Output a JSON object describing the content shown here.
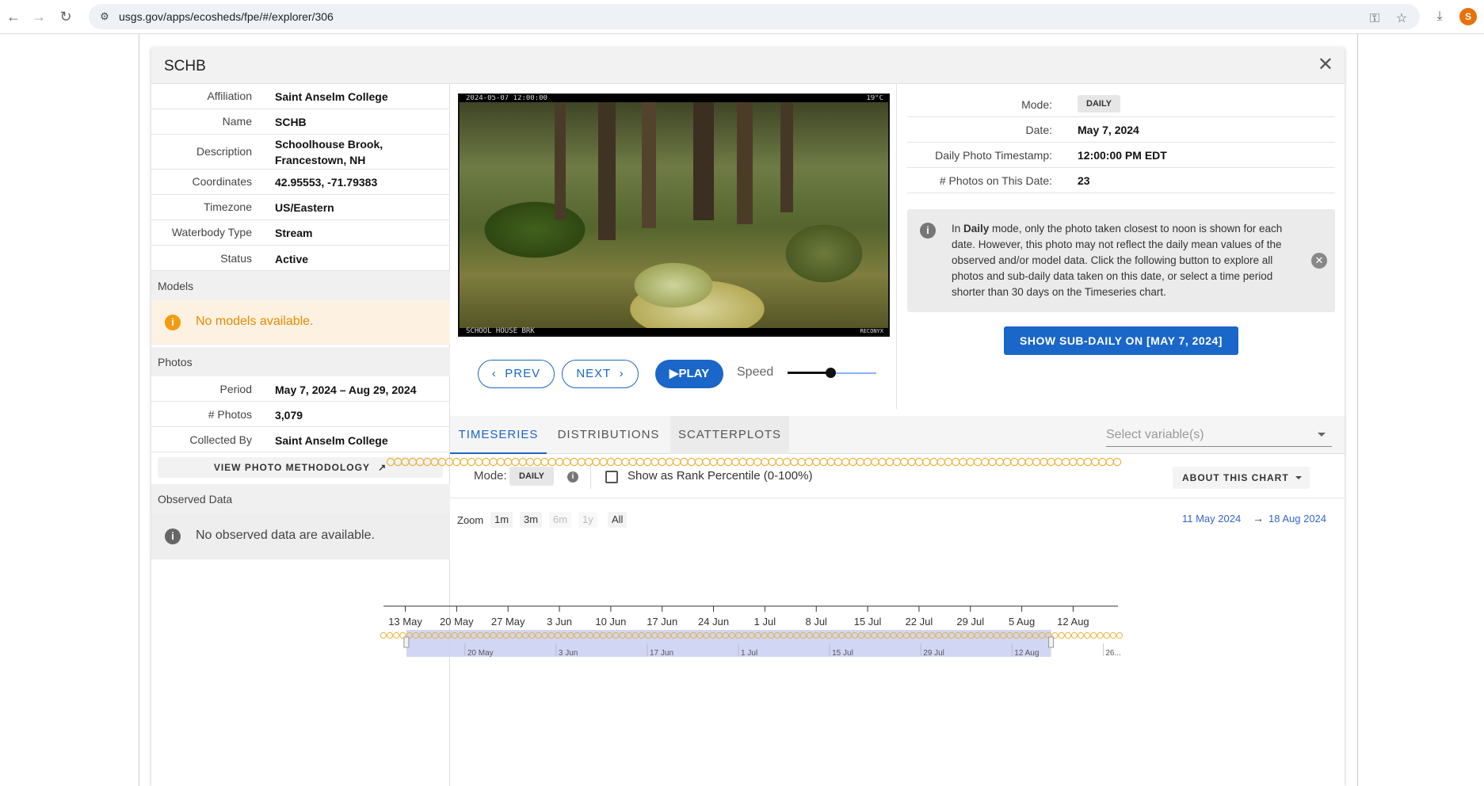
{
  "browser": {
    "url": "usgs.gov/apps/ecosheds/fpe/#/explorer/306",
    "profile_initial": "S"
  },
  "panel": {
    "title": "SCHB",
    "info": [
      {
        "label": "Affiliation",
        "value": "Saint Anselm College"
      },
      {
        "label": "Name",
        "value": "SCHB"
      },
      {
        "label": "Description",
        "value": "Schoolhouse Brook, Francestown, NH"
      },
      {
        "label": "Coordinates",
        "value": "42.95553, -71.79383"
      },
      {
        "label": "Timezone",
        "value": "US/Eastern"
      },
      {
        "label": "Waterbody Type",
        "value": "Stream"
      },
      {
        "label": "Status",
        "value": "Active"
      }
    ],
    "models_header": "Models",
    "models_alert": "No models available.",
    "photos_header": "Photos",
    "photos": [
      {
        "label": "Period",
        "value": "May 7, 2024 – Aug 29, 2024"
      },
      {
        "label": "# Photos",
        "value": "3,079"
      },
      {
        "label": "Collected By",
        "value": "Saint Anselm College"
      }
    ],
    "methodology_button": "VIEW PHOTO METHODOLOGY",
    "observed_header": "Observed Data",
    "observed_alert": "No observed data are available."
  },
  "photo": {
    "overlay_top_left": "2024-05-07 12:00:00",
    "overlay_top_right": "19°C",
    "overlay_bottom_left": "SCHOOL HOUSE BRK",
    "overlay_bottom_right": "RECONYX"
  },
  "controls": {
    "prev": "PREV",
    "next": "NEXT",
    "play": "PLAY",
    "speed_label": "Speed",
    "speed_level": 0.48
  },
  "meta": [
    {
      "label": "Mode:",
      "value": "DAILY",
      "chip": true
    },
    {
      "label": "Date:",
      "value": "May 7, 2024"
    },
    {
      "label": "Daily Photo Timestamp:",
      "value": "12:00:00 PM EDT"
    },
    {
      "label": "# Photos on This Date:",
      "value": "23"
    }
  ],
  "info_box": {
    "pre": "In ",
    "bold": "Daily",
    "post": " mode, only the photo taken closest to noon is shown for each date. However, this photo may not reflect the daily mean values of the observed and/or model data. Click the following button to explore all photos and sub-daily data taken on this date, or select a time period shorter than 30 days on the Timeseries chart."
  },
  "sub_daily_button": "SHOW SUB-DAILY ON [MAY 7, 2024]",
  "tabs": [
    "TIMESERIES",
    "DISTRIBUTIONS",
    "SCATTERPLOTS"
  ],
  "select_variables_placeholder": "Select variable(s)",
  "options": {
    "mode_label": "Mode:",
    "mode_value": "DAILY",
    "rank_label": "Show as Rank Percentile (0-100%)",
    "about_button": "ABOUT THIS CHART"
  },
  "zoom": {
    "label": "Zoom",
    "buttons": [
      {
        "label": "1m",
        "enabled": true
      },
      {
        "label": "3m",
        "enabled": true
      },
      {
        "label": "6m",
        "enabled": false
      },
      {
        "label": "1y",
        "enabled": false
      },
      {
        "label": "All",
        "enabled": true
      }
    ],
    "from": "11 May 2024",
    "to": "18 Aug 2024"
  },
  "chart_data": {
    "type": "scatter",
    "series_color": "#e8b23a",
    "x_ticks": [
      "13 May",
      "20 May",
      "27 May",
      "3 Jun",
      "10 Jun",
      "17 Jun",
      "24 Jun",
      "1 Jul",
      "8 Jul",
      "15 Jul",
      "22 Jul",
      "29 Jul",
      "5 Aug",
      "12 Aug"
    ],
    "photo_days_visible_start": "2024-05-11",
    "photo_days_visible_end": "2024-08-18",
    "navigator": {
      "ticks": [
        "20 May",
        "3 Jun",
        "17 Jun",
        "1 Jul",
        "15 Jul",
        "29 Jul",
        "12 Aug",
        "26..."
      ],
      "selection_start": "2024-05-11",
      "selection_end": "2024-08-18",
      "data_start": "2024-05-07",
      "data_end": "2024-08-29"
    }
  },
  "colors": {
    "accent": "#1a66c9",
    "warning": "#e68a00",
    "marker": "#e8b23a"
  }
}
